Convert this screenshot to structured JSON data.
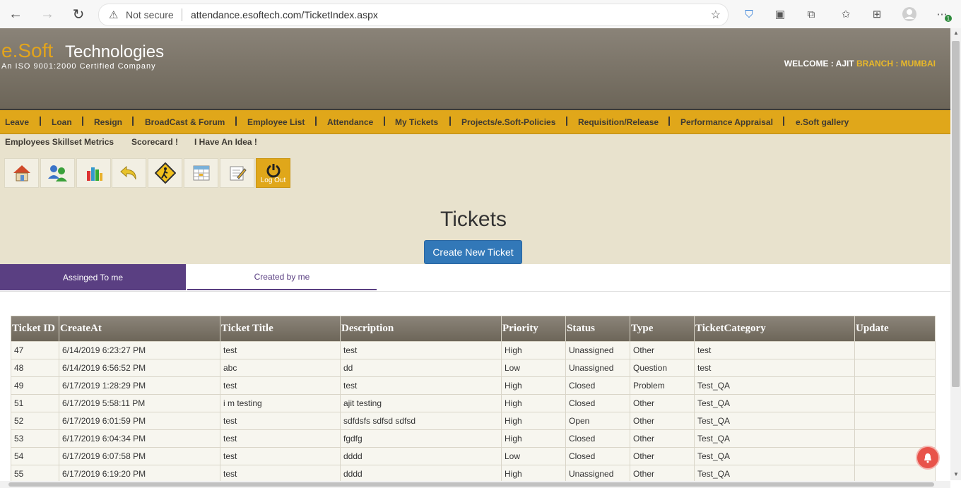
{
  "browser": {
    "not_secure": "Not secure",
    "url": "attendance.esoftech.com/TicketIndex.aspx",
    "ext_badge": "1"
  },
  "header": {
    "logo_brand": "e.Soft",
    "logo_name": "Technologies",
    "tagline": "An ISO 9001:2000 Certified Company",
    "welcome_prefix": "WELCOME : AJIT",
    "branch": "BRANCH : MUMBAI"
  },
  "menu": {
    "items": [
      "Leave",
      "Loan",
      "Resign",
      "BroadCast & Forum",
      "Employee List",
      "Attendance",
      "My Tickets",
      "Projects/e.Soft-Policies",
      "Requisition/Release",
      "Performance Appraisal",
      "e.Soft gallery"
    ]
  },
  "submenu": {
    "items": [
      "Employees Skillset Metrics",
      "Scorecard !",
      "I Have An Idea !"
    ]
  },
  "quick_buttons": {
    "logout_label": "Log Out"
  },
  "page": {
    "title": "Tickets",
    "create_button": "Create New Ticket"
  },
  "tabs": {
    "assigned": "Assinged To me",
    "created": "Created by me"
  },
  "table": {
    "headers": [
      "Ticket ID",
      "CreateAt",
      "Ticket Title",
      "Description",
      "Priority",
      "Status",
      "Type",
      "TicketCategory",
      "Update"
    ],
    "rows": [
      [
        "47",
        "6/14/2019 6:23:27 PM",
        "test",
        "test",
        "High",
        "Unassigned",
        "Other",
        "test",
        ""
      ],
      [
        "48",
        "6/14/2019 6:56:52 PM",
        "abc",
        "dd",
        "Low",
        "Unassigned",
        "Question",
        "test",
        ""
      ],
      [
        "49",
        "6/17/2019 1:28:29 PM",
        "test",
        "test",
        "High",
        "Closed",
        "Problem",
        "Test_QA",
        ""
      ],
      [
        "51",
        "6/17/2019 5:58:11 PM",
        "i m testing",
        "ajit testing",
        "High",
        "Closed",
        "Other",
        "Test_QA",
        ""
      ],
      [
        "52",
        "6/17/2019 6:01:59 PM",
        "test",
        "sdfdsfs sdfsd sdfsd",
        "High",
        "Open",
        "Other",
        "Test_QA",
        ""
      ],
      [
        "53",
        "6/17/2019 6:04:34 PM",
        "test",
        "fgdfg",
        "High",
        "Closed",
        "Other",
        "Test_QA",
        ""
      ],
      [
        "54",
        "6/17/2019 6:07:58 PM",
        "test",
        "dddd",
        "Low",
        "Closed",
        "Other",
        "Test_QA",
        ""
      ],
      [
        "55",
        "6/17/2019 6:19:20 PM",
        "test",
        "dddd",
        "High",
        "Unassigned",
        "Other",
        "Test_QA",
        ""
      ]
    ]
  }
}
